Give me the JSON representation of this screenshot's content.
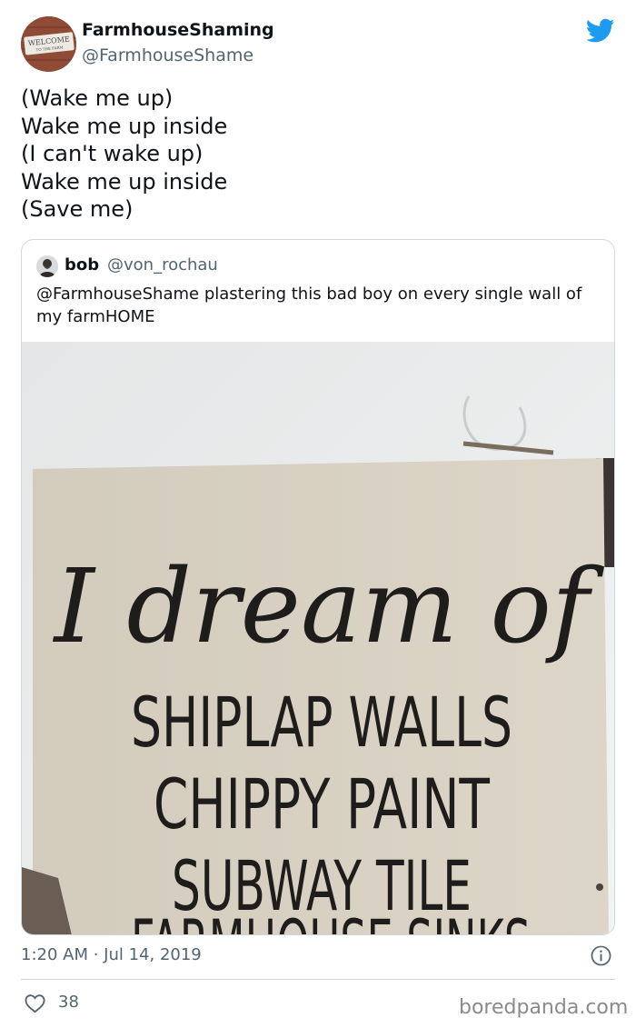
{
  "author": {
    "display_name": "FarmhouseShaming",
    "handle": "@FarmhouseShame",
    "avatar_sign_text": "WELCOME",
    "avatar_sign_subtext": "TO THE FARM"
  },
  "tweet": {
    "lines": [
      "(Wake me up)",
      "Wake me up inside",
      "(I can't wake up)",
      "Wake me up inside",
      "(Save me)"
    ]
  },
  "quoted_tweet": {
    "display_name": "bob",
    "handle": "@von_rochau",
    "text": "@FarmhouseShame plastering this bad boy on every single wall of my farmHOME",
    "image": {
      "script_text": "I dream of",
      "lines": [
        "SHIPLAP WALLS",
        "CHIPPY PAINT",
        "SUBWAY TILE",
        "FARMHOUSE SINKS"
      ]
    }
  },
  "meta": {
    "timestamp": "1:20 AM · Jul 14, 2019",
    "likes": "38"
  },
  "watermark": "boredpanda.com",
  "icons": {
    "platform": "twitter-bird-icon",
    "info": "info-icon",
    "like": "heart-icon"
  },
  "colors": {
    "twitter_blue": "#1d9bf0",
    "text_primary": "#0f1419",
    "text_secondary": "#536471",
    "border": "#cfd9de"
  }
}
